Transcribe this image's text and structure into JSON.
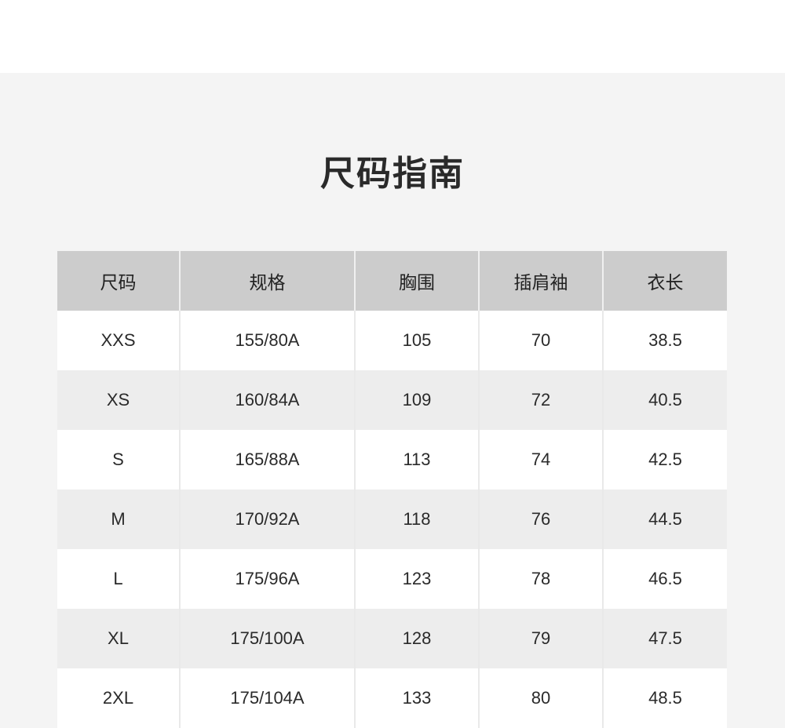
{
  "title": "尺码指南",
  "columns": [
    "尺码",
    "规格",
    "胸围",
    "插肩袖",
    "衣长"
  ],
  "rows": [
    [
      "XXS",
      "155/80A",
      "105",
      "70",
      "38.5"
    ],
    [
      "XS",
      "160/84A",
      "109",
      "72",
      "40.5"
    ],
    [
      "S",
      "165/88A",
      "113",
      "74",
      "42.5"
    ],
    [
      "M",
      "170/92A",
      "118",
      "76",
      "44.5"
    ],
    [
      "L",
      "175/96A",
      "123",
      "78",
      "46.5"
    ],
    [
      "XL",
      "175/100A",
      "128",
      "79",
      "47.5"
    ],
    [
      "2XL",
      "175/104A",
      "133",
      "80",
      "48.5"
    ]
  ],
  "colors": {
    "panel_background": "#f4f4f4",
    "header_background": "#cccccc",
    "row_alt_background": "#ededed",
    "row_background": "#ffffff"
  }
}
